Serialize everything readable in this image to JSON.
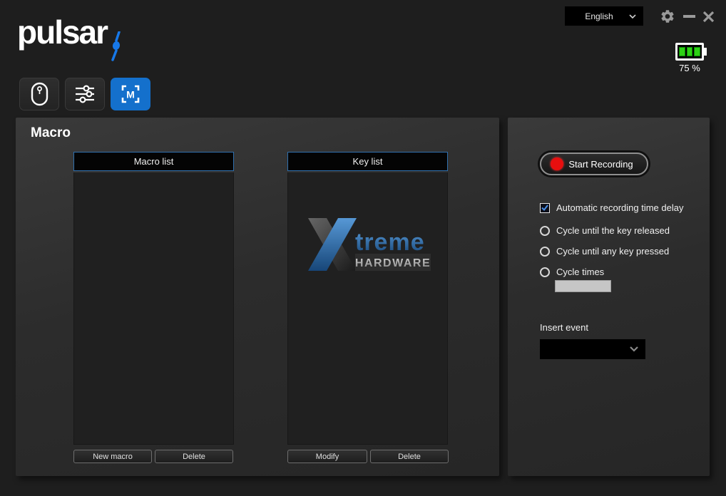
{
  "header": {
    "logo_text": "pulsar",
    "language_selector": {
      "value": "English"
    },
    "battery": {
      "percent_label": "75 %",
      "bars": 3,
      "color": "#2dd114"
    },
    "window_controls": {
      "settings": "gear-icon",
      "minimize": "minimize-icon",
      "close": "close-icon"
    }
  },
  "tabs": [
    {
      "id": "mouse",
      "icon": "mouse-icon",
      "active": false
    },
    {
      "id": "performance",
      "icon": "sliders-icon",
      "active": false
    },
    {
      "id": "macro",
      "icon": "macro-icon",
      "icon_label": "M",
      "active": true
    }
  ],
  "macro_panel": {
    "title": "Macro",
    "macro_list": {
      "header": "Macro list",
      "items": [],
      "buttons": [
        "New macro",
        "Delete"
      ]
    },
    "key_list": {
      "header": "Key list",
      "items": [],
      "buttons": [
        "Modify",
        "Delete"
      ],
      "watermark": {
        "line1": "treme",
        "line2": "HARDWARE"
      }
    }
  },
  "recording_panel": {
    "start_button": "Start Recording",
    "auto_delay_checkbox": {
      "label": "Automatic recording time delay",
      "checked": true
    },
    "cycle_options": [
      {
        "label": "Cycle until the key released",
        "selected": false
      },
      {
        "label": "Cycle until any key pressed",
        "selected": false
      },
      {
        "label": "Cycle times",
        "selected": false
      }
    ],
    "cycle_times_value": "",
    "insert_event": {
      "label": "Insert event",
      "value": ""
    }
  },
  "colors": {
    "accent_blue": "#1470cc",
    "list_border_blue": "#2f6fad",
    "record_red": "#e80f0f",
    "battery_green": "#2dd114"
  }
}
